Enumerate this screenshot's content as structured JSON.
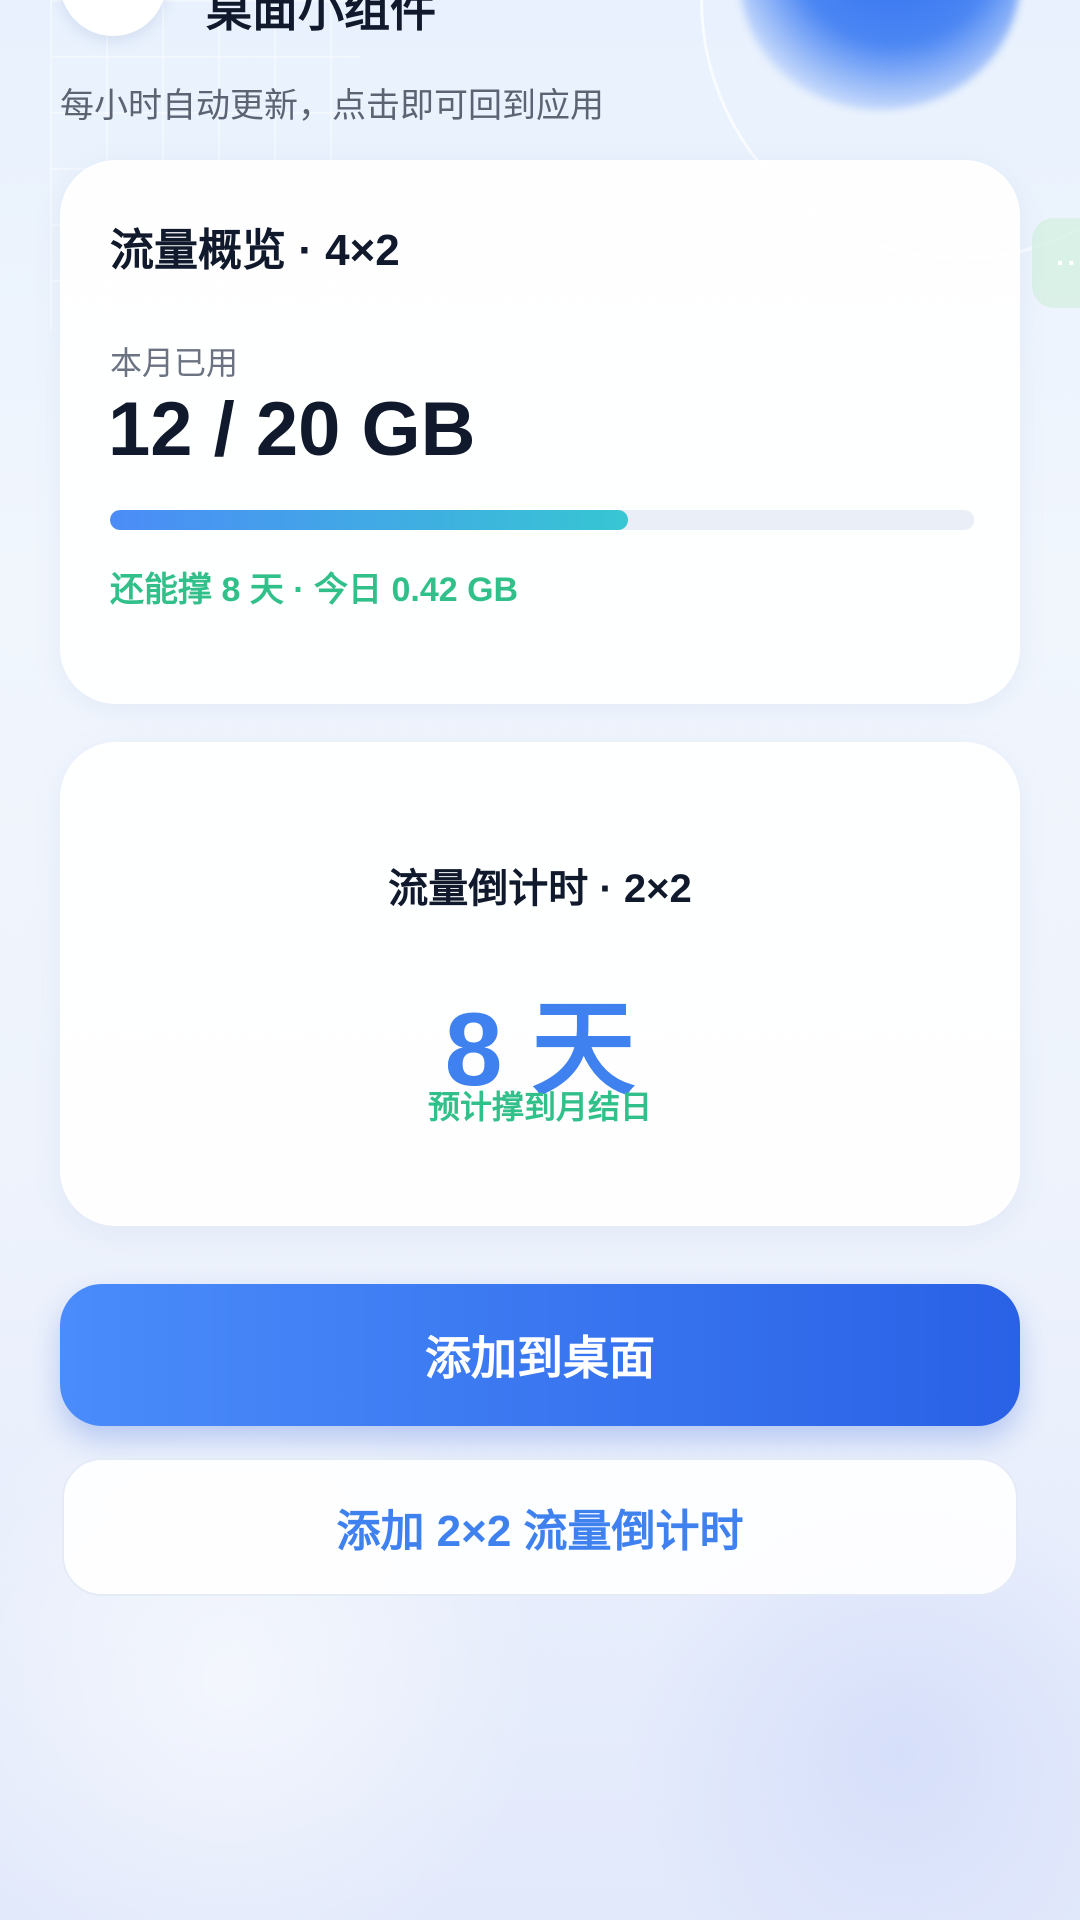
{
  "header": {
    "title": "桌面小组件",
    "subtitle": "每小时自动更新，点击即可回到应用"
  },
  "side_tab": {
    "label": "··"
  },
  "overview_card": {
    "title": "流量概览 · 4×2",
    "label": "本月已用",
    "value": "12 / 20 GB",
    "used_gb": 12,
    "total_gb": 20,
    "progress_fraction": 0.6,
    "stats": "还能撑 8 天 · 今日 0.42 GB"
  },
  "countdown_card": {
    "title": "流量倒计时 · 2×2",
    "value": "8 天",
    "caption": "预计撑到月结日"
  },
  "buttons": {
    "add_to_desktop": "添加到桌面",
    "add_countdown": "添加 2×2 流量倒计时"
  },
  "colors": {
    "accent_blue": "#3f82ef",
    "accent_green": "#32c08a",
    "progress_start": "#4b8cf7",
    "progress_end": "#37c6d3",
    "text_dark": "#111a2c"
  }
}
